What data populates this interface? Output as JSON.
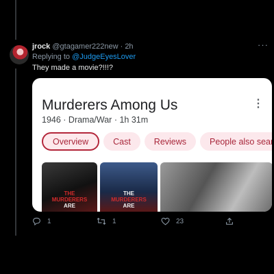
{
  "tweet": {
    "name": "jrock",
    "handle": "@gtagamer222new",
    "separator": " · ",
    "time": "2h",
    "replying_prefix": "Replying to ",
    "replying_to": "@JudgeEyesLover",
    "text": "They made a movie?!!!?",
    "more_glyph": "···"
  },
  "card": {
    "title": "Murderers Among Us",
    "meta": "1946 · Drama/War · 1h 31m",
    "menu_glyph": "⋮",
    "chips": [
      "Overview",
      "Cast",
      "Reviews",
      "People also search for"
    ],
    "active_chip": 0,
    "poster_text": {
      "line1": "THE",
      "line2": "MURDERERS",
      "line3": "ARE"
    }
  },
  "actions": {
    "reply_count": "1",
    "retweet_count": "1",
    "like_count": "23"
  },
  "colors": {
    "background": "#000000",
    "link": "#1d9bf0",
    "chip_bg": "#fce8ec",
    "chip_text": "#a8263a"
  }
}
